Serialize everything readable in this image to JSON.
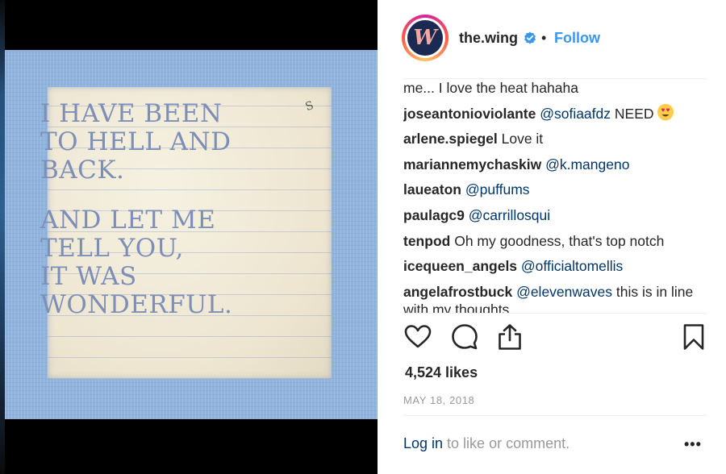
{
  "photo": {
    "text_lines_1": [
      "I HAVE BEEN",
      "TO HELL AND",
      "BACK."
    ],
    "text_lines_2": [
      "AND LET ME",
      "TELL YOU,",
      "IT WAS",
      "WONDERFUL."
    ],
    "corner_mark": "S"
  },
  "header": {
    "avatar_letter": "W",
    "username": "the.wing",
    "separator": "•",
    "follow_label": "Follow"
  },
  "comments": [
    {
      "user": "",
      "mention": "",
      "text": "me... I love the heat hahaha"
    },
    {
      "user": "joseantonioviolante",
      "mention": "@sofiaafdz",
      "text": "NEED"
    },
    {
      "user": "arlene.spiegel",
      "mention": "",
      "text": "Love it"
    },
    {
      "user": "mariannemychaskiw",
      "mention": "@k.mangeno",
      "text": ""
    },
    {
      "user": "laueaton",
      "mention": "@puffums",
      "text": ""
    },
    {
      "user": "paulagc9",
      "mention": "@carrillosqui",
      "text": ""
    },
    {
      "user": "tenpod",
      "mention": "",
      "text": "Oh my goodness, that's top notch"
    },
    {
      "user": "icequeen_angels",
      "mention": "@officialtomellis",
      "text": ""
    },
    {
      "user": "angelafrostbuck",
      "mention": "@elevenwaves",
      "text": "this is in line with my thoughts"
    }
  ],
  "icons": {
    "like": "heart-icon",
    "comment": "comment-bubble-icon",
    "share": "share-icon",
    "save": "bookmark-icon",
    "verified": "verified-badge-icon",
    "emoji": "heart-eyes-emoji"
  },
  "likes": "4,524 likes",
  "date": "MAY 18, 2018",
  "footer": {
    "login_link": "Log in",
    "login_text": " to like or comment.",
    "more_label": "•••"
  },
  "colors": {
    "link_blue": "#3897f0",
    "mention_blue": "#003569",
    "text": "#262626",
    "muted": "#999999"
  }
}
